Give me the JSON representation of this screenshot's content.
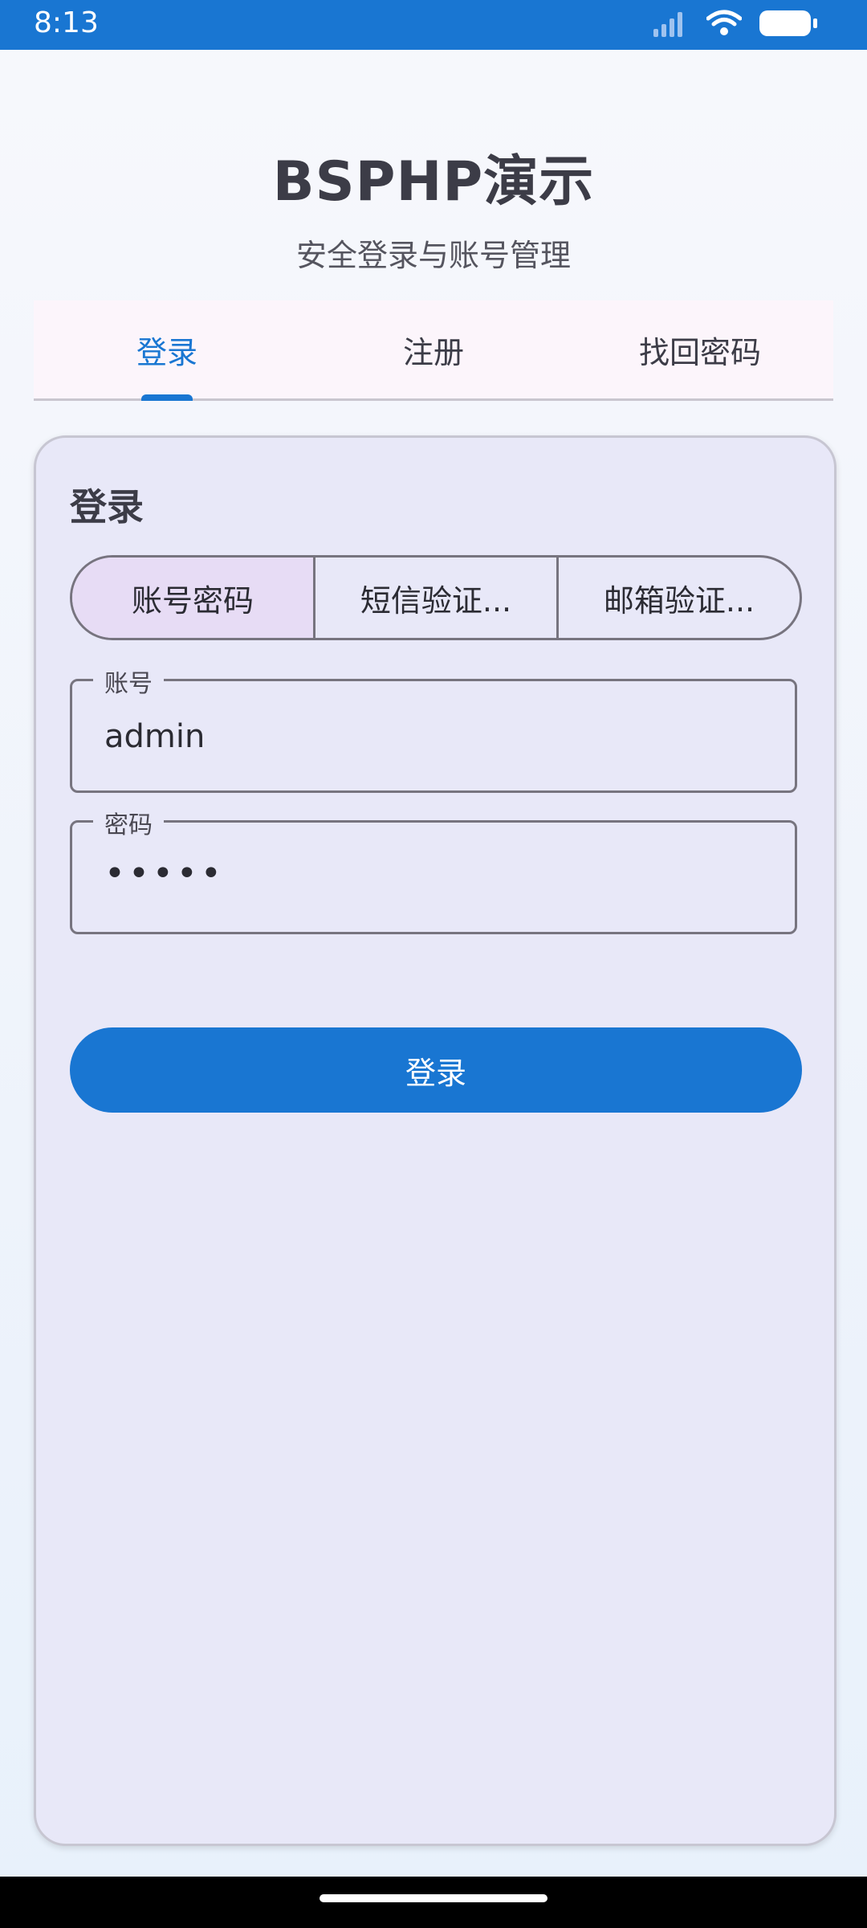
{
  "status_bar": {
    "time": "8:13",
    "icons": [
      "signal-icon",
      "wifi-icon",
      "battery-icon"
    ]
  },
  "header": {
    "title": "BSPHP演示",
    "subtitle": "安全登录与账号管理"
  },
  "tabs": [
    {
      "label": "登录",
      "active": true
    },
    {
      "label": "注册",
      "active": false
    },
    {
      "label": "找回密码",
      "active": false
    }
  ],
  "card": {
    "title": "登录",
    "methods": [
      {
        "label": "账号密码",
        "selected": true
      },
      {
        "label": "短信验证...",
        "selected": false
      },
      {
        "label": "邮箱验证...",
        "selected": false
      }
    ],
    "account_field": {
      "label": "账号",
      "value": "admin"
    },
    "password_field": {
      "label": "密码",
      "value": "•••••"
    },
    "submit_label": "登录"
  },
  "colors": {
    "primary": "#1976d2",
    "card_bg": "#e8e8f8",
    "selected_segment": "#e7dcf5"
  }
}
